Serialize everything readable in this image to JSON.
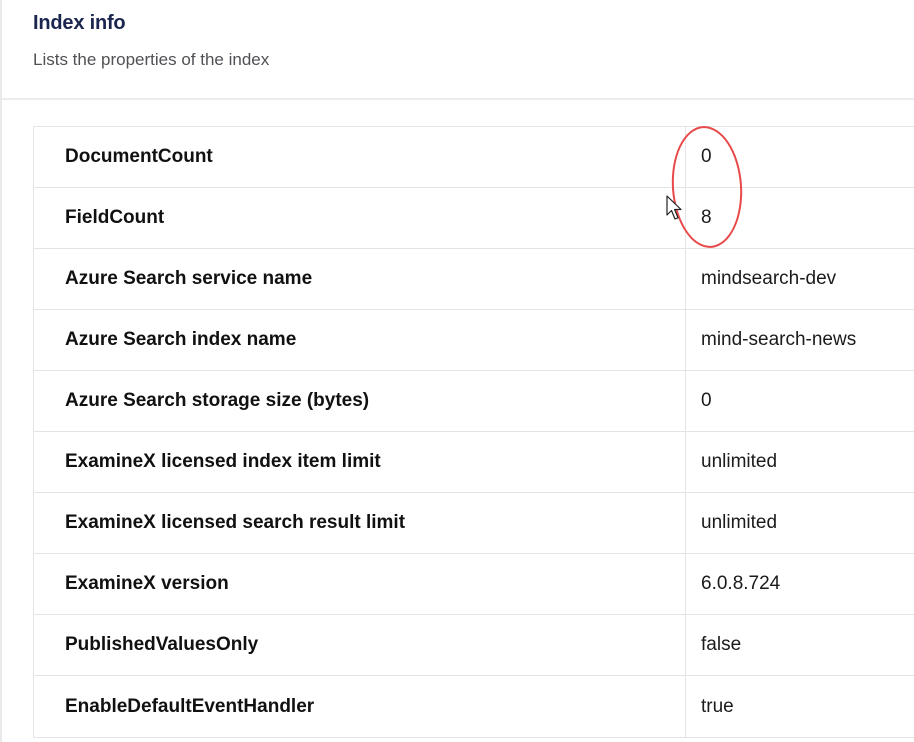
{
  "header": {
    "title": "Index info",
    "subtitle": "Lists the properties of the index"
  },
  "properties": [
    {
      "key": "DocumentCount",
      "value": "0"
    },
    {
      "key": "FieldCount",
      "value": "8"
    },
    {
      "key": "Azure Search service name",
      "value": "mindsearch-dev"
    },
    {
      "key": "Azure Search index name",
      "value": "mind-search-news"
    },
    {
      "key": "Azure Search storage size (bytes)",
      "value": "0"
    },
    {
      "key": "ExamineX licensed index item limit",
      "value": "unlimited"
    },
    {
      "key": "ExamineX licensed search result limit",
      "value": "unlimited"
    },
    {
      "key": "ExamineX version",
      "value": "6.0.8.724"
    },
    {
      "key": "PublishedValuesOnly",
      "value": "false"
    },
    {
      "key": "EnableDefaultEventHandler",
      "value": "true"
    }
  ],
  "annotation_color": "#e84848",
  "icons": {
    "cursor": "mouse-pointer-icon"
  }
}
